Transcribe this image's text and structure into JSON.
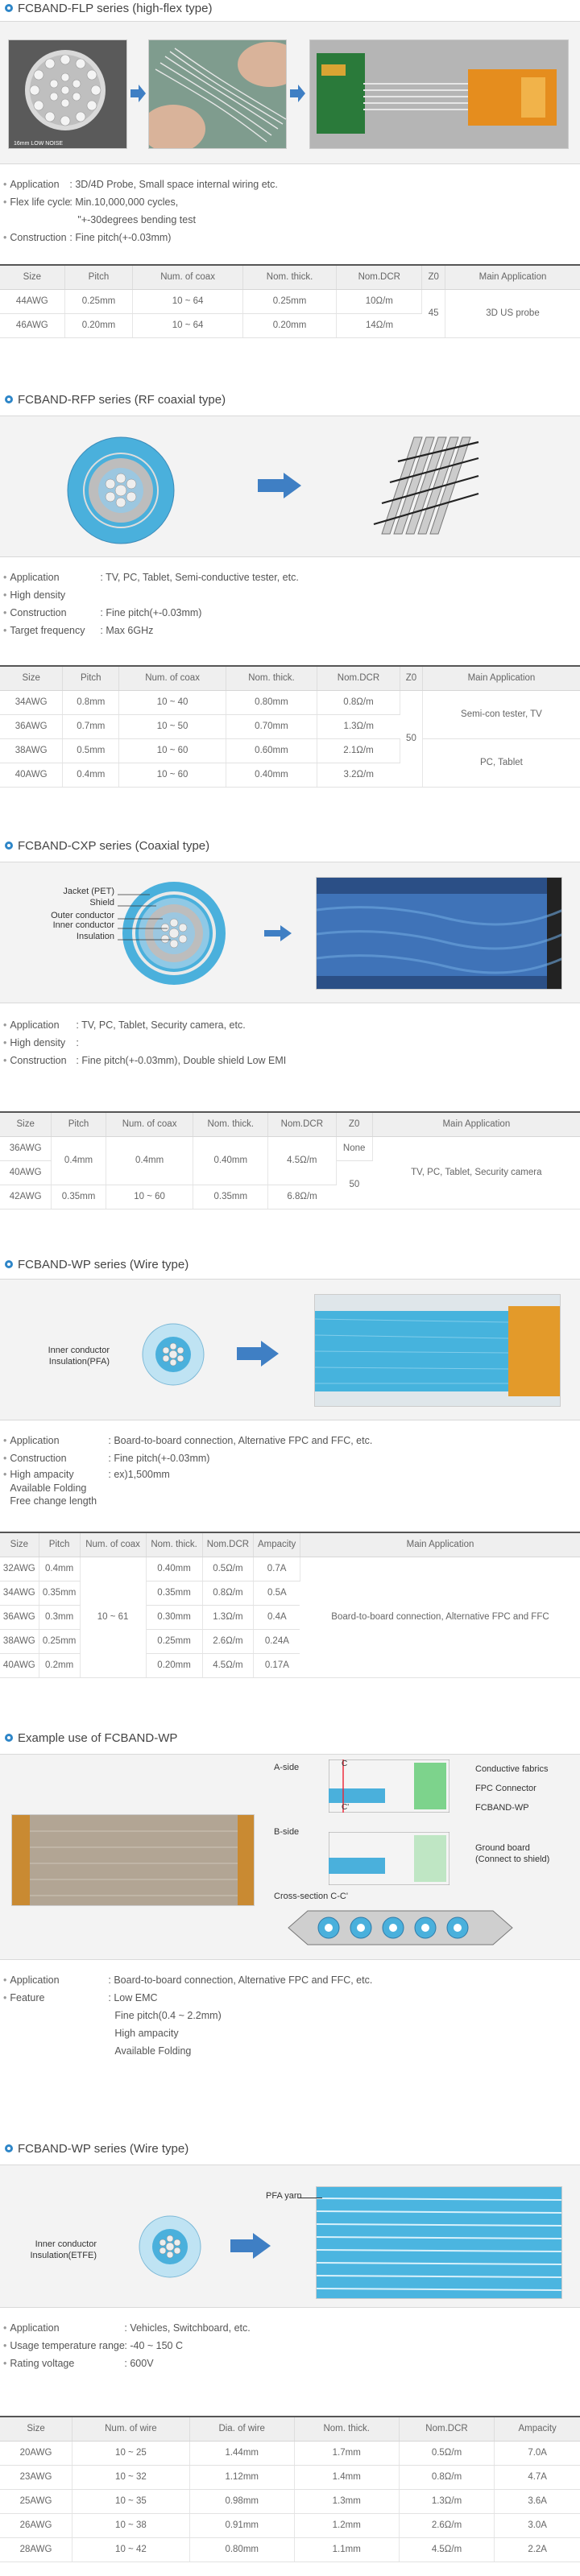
{
  "sections": [
    {
      "title": "FCBAND-FLP series (high-flex type)",
      "specs": [
        {
          "k": "Application",
          "v": ": 3D/4D Probe, Small space internal wiring etc."
        },
        {
          "k": "Flex life cycle",
          "v": ": Min.10,000,000 cycles,"
        },
        {
          "k": "",
          "v": "\"+-30degrees bending test"
        },
        {
          "k": "Construction",
          "v": ": Fine pitch(+-0.03mm)"
        }
      ],
      "headers": [
        "Size",
        "Pitch",
        "Num. of coax",
        "Nom. thick.",
        "Nom.DCR",
        "Z0",
        "Main Application"
      ],
      "rows": [
        [
          "44AWG",
          "0.25mm",
          "10 ~ 64",
          "0.25mm",
          "10Ω/m"
        ],
        [
          "46AWG",
          "0.20mm",
          "10 ~ 64",
          "0.20mm",
          "14Ω/m"
        ]
      ],
      "merged": [
        {
          "col": 5,
          "text": "45"
        },
        {
          "col": 6,
          "text": "3D US probe"
        }
      ],
      "photo_caption": "16mm LOW NOISE"
    },
    {
      "title": "FCBAND-RFP series (RF coaxial type)",
      "specs": [
        {
          "k": "Application",
          "v": ": TV, PC, Tablet, Semi-conductive tester, etc."
        },
        {
          "k": "High density",
          "v": ""
        },
        {
          "k": "Construction",
          "v": ": Fine pitch(+-0.03mm)"
        },
        {
          "k": "Target frequency",
          "v": ": Max 6GHz"
        }
      ],
      "headers": [
        "Size",
        "Pitch",
        "Num. of coax",
        "Nom. thick.",
        "Nom.DCR",
        "Z0",
        "Main Application"
      ],
      "rows": [
        [
          "34AWG",
          "0.8mm",
          "10 ~ 40",
          "0.80mm",
          "0.8Ω/m"
        ],
        [
          "36AWG",
          "0.7mm",
          "10 ~ 50",
          "0.70mm",
          "1.3Ω/m"
        ],
        [
          "38AWG",
          "0.5mm",
          "10 ~ 60",
          "0.60mm",
          "2.1Ω/m"
        ],
        [
          "40AWG",
          "0.4mm",
          "10 ~ 60",
          "0.40mm",
          "3.2Ω/m"
        ]
      ],
      "z0": "50",
      "app1": "Semi-con tester, TV",
      "app2": "PC, Tablet"
    },
    {
      "title": "FCBAND-CXP series (Coaxial type)",
      "labels": [
        "Jacket (PET)",
        "Shield",
        "Outer conductor",
        "Inner conductor",
        "Insulation"
      ],
      "specs": [
        {
          "k": "Application",
          "v": ": TV, PC, Tablet, Security camera, etc."
        },
        {
          "k": "High density",
          "v": ":"
        },
        {
          "k": "Construction",
          "v": ": Fine pitch(+-0.03mm), Double shield  Low EMI"
        }
      ],
      "headers": [
        "Size",
        "Pitch",
        "Num. of coax",
        "Nom. thick.",
        "Nom.DCR",
        "Z0",
        "Main Application"
      ],
      "rows": [
        [
          "36AWG",
          "0.4mm",
          "0.4mm",
          "0.40mm",
          "4.5Ω/m"
        ],
        [
          "40AWG",
          "",
          ""
        ],
        [
          "42AWG",
          "0.35mm",
          "10 ~ 60",
          "0.35mm",
          "6.8Ω/m"
        ]
      ],
      "z0a": "None",
      "z0b": "50",
      "app": "TV, PC, Tablet, Security camera"
    },
    {
      "title": "FCBAND-WP series (Wire type)",
      "labels": [
        "Inner conductor",
        "Insulation(PFA)"
      ],
      "specs": [
        {
          "k": "Application",
          "v": ": Board-to-board connection, Alternative FPC and FFC, etc."
        },
        {
          "k": "Construction",
          "v": ": Fine pitch(+-0.03mm)"
        },
        {
          "k": "High ampacity",
          "v": ": ex)1,500mm"
        },
        {
          "k": "Available Folding",
          "v": ""
        },
        {
          "k": "Free change length",
          "v": ""
        }
      ],
      "headers": [
        "Size",
        "Pitch",
        "Num. of coax",
        "Nom. thick.",
        "Nom.DCR",
        "Ampacity",
        "Main Application"
      ],
      "rows": [
        [
          "32AWG",
          "0.4mm",
          "0.40mm",
          "0.5Ω/m",
          "0.7A"
        ],
        [
          "34AWG",
          "0.35mm",
          "0.35mm",
          "0.8Ω/m",
          "0.5A"
        ],
        [
          "36AWG",
          "0.3mm",
          "0.30mm",
          "1.3Ω/m",
          "0.4A"
        ],
        [
          "38AWG",
          "0.25mm",
          "0.25mm",
          "2.6Ω/m",
          "0.24A"
        ],
        [
          "40AWG",
          "0.2mm",
          "0.20mm",
          "4.5Ω/m",
          "0.17A"
        ]
      ],
      "coax": "10 ~ 61",
      "app": "Board-to-board connection, Alternative FPC and FFC"
    },
    {
      "title": "Example use of FCBAND-WP",
      "labels": {
        "aside": "A-side",
        "bside": "B-side",
        "cross": "Cross-section C-C'",
        "c": "C",
        "c2": "C'",
        "fab": "Conductive fabrics",
        "fpc": "FPC Connector",
        "wp": "FCBAND-WP",
        "ground": "Ground board",
        "ground2": "(Connect to shield)"
      },
      "specs": [
        {
          "k": "Application",
          "v": ": Board-to-board connection, Alternative FPC and FFC, etc."
        },
        {
          "k": "Feature",
          "v": ": Low EMC"
        },
        {
          "k": "",
          "v": "Fine pitch(0.4 ~ 2.2mm)"
        },
        {
          "k": "",
          "v": "High ampacity"
        },
        {
          "k": "",
          "v": "Available Folding"
        }
      ]
    },
    {
      "title": "FCBAND-WP series (Wire type)",
      "labels": [
        "Inner conductor",
        "Insulation(ETFE)",
        "PFA yarn"
      ],
      "specs": [
        {
          "k": "Application",
          "v": ": Vehicles, Switchboard, etc."
        },
        {
          "k": "Usage temperature range",
          "v": ": -40 ~ 150 C"
        },
        {
          "k": "Rating voltage",
          "v": ": 600V"
        }
      ],
      "headers": [
        "Size",
        "Num. of wire",
        "Dia. of wire",
        "Nom. thick.",
        "Nom.DCR",
        "Ampacity"
      ],
      "rows": [
        [
          "20AWG",
          "10 ~ 25",
          "1.44mm",
          "1.7mm",
          "0.5Ω/m",
          "7.0A"
        ],
        [
          "23AWG",
          "10 ~ 32",
          "1.12mm",
          "1.4mm",
          "0.8Ω/m",
          "4.7A"
        ],
        [
          "25AWG",
          "10 ~ 35",
          "0.98mm",
          "1.3mm",
          "1.3Ω/m",
          "3.6A"
        ],
        [
          "26AWG",
          "10 ~ 38",
          "0.91mm",
          "1.2mm",
          "2.6Ω/m",
          "3.0A"
        ],
        [
          "28AWG",
          "10 ~ 42",
          "0.80mm",
          "1.1mm",
          "4.5Ω/m",
          "2.2A"
        ]
      ]
    }
  ],
  "colors": {
    "accent": "#2e86c8",
    "arrow": "#3f7fc4",
    "cable": "#4ab0dc"
  }
}
